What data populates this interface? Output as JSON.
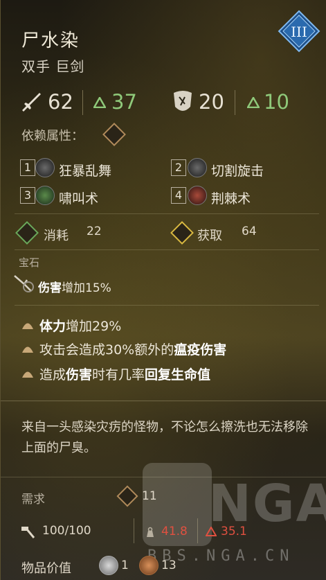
{
  "item": {
    "name": "尸水染",
    "type": "双手 巨剑",
    "tier": "III"
  },
  "stats": {
    "damage": "62",
    "damage_bonus": "37",
    "defense": "20",
    "defense_bonus": "10"
  },
  "dependency": {
    "label": "依赖属性："
  },
  "skills": [
    {
      "num": "1",
      "name": "狂暴乱舞"
    },
    {
      "num": "2",
      "name": "切割旋击"
    },
    {
      "num": "3",
      "name": "啸叫术"
    },
    {
      "num": "4",
      "name": "荆棘术"
    }
  ],
  "costs": {
    "consume_label": "消耗",
    "consume_value": "22",
    "gain_label": "获取",
    "gain_value": "64"
  },
  "gem": {
    "label": "宝石",
    "effect_bold": "伤害",
    "effect_rest": "增加15%"
  },
  "affixes": [
    {
      "bold1": "体力",
      "text1": "增加29%"
    },
    {
      "text1": "攻击会造成30%额外的",
      "bold1": "瘟疫伤害"
    },
    {
      "text1": "造成",
      "bold1": "伤害",
      "text2": "时有几率",
      "bold2": "回复生命值"
    }
  ],
  "description": "来自一头感染灾疠的怪物，不论怎么擦洗也无法移除上面的尸臭。",
  "requirements": {
    "label": "需求",
    "value": "11"
  },
  "durability": {
    "value": "100/100",
    "weight": "41.8",
    "weight2": "35.1"
  },
  "value": {
    "label": "物品价值",
    "silver": "1",
    "copper": "13"
  },
  "watermark": {
    "text": "NGA",
    "url": "BBS.NGA.CN"
  },
  "colors": {
    "green": "#8fc97a",
    "red": "#e05040",
    "tier_blue": "#3a7fc4"
  }
}
